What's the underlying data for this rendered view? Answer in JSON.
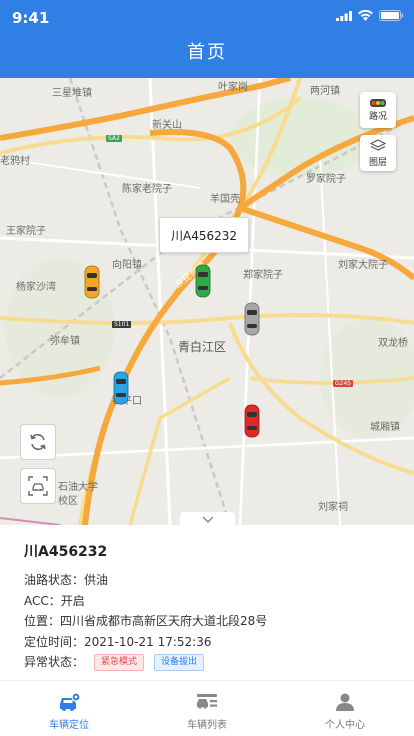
{
  "status_bar": {
    "time": "9:41"
  },
  "header": {
    "title": "首页"
  },
  "map": {
    "layer_buttons": [
      {
        "label": "路况",
        "icon": "traffic-light-icon"
      },
      {
        "label": "图层",
        "icon": "layers-icon"
      }
    ],
    "place_labels": [
      "三星堆镇",
      "叶家岗",
      "新关山",
      "老鸦村",
      "陈家老院子",
      "羊国壳",
      "罗家院子",
      "王家院子",
      "向阳镇",
      "郑家院子",
      "刘家大院子",
      "杨家沙湾",
      "弥牟镇",
      "青白江区",
      "双龙桥",
      "石平口",
      "城厢镇",
      "石油大学",
      "校区",
      "刘家祠",
      "两河镇"
    ],
    "road_badges": [
      "SA2",
      "S101",
      "G245"
    ],
    "expressway_label": "京昆高速",
    "popup_plate": "川A456232",
    "vehicles": [
      {
        "color": "#f5a623",
        "icon": "car-orange-icon"
      },
      {
        "color": "#2eaa4a",
        "icon": "car-green-icon"
      },
      {
        "color": "#9a9a9a",
        "icon": "car-gray-icon"
      },
      {
        "color": "#2ba3e6",
        "icon": "car-blue-icon"
      },
      {
        "color": "#e02a2a",
        "icon": "car-red-icon"
      }
    ]
  },
  "info": {
    "plate": "川A456232",
    "oil_label": "油路状态：",
    "oil_value": "供油",
    "acc_label": "ACC：",
    "acc_value": "开启",
    "location_label": "位置：",
    "location_value": "四川省成都市高新区天府大道北段28号",
    "time_label": "定位时间：",
    "time_value": "2021-10-21 17:52:36",
    "abnormal_label": "异常状态：",
    "tags": [
      "紧急模式",
      "设备拔出"
    ]
  },
  "tabbar": {
    "items": [
      {
        "label": "车辆定位",
        "icon": "car-location-icon",
        "active": true
      },
      {
        "label": "车辆列表",
        "icon": "vehicle-list-icon",
        "active": false
      },
      {
        "label": "个人中心",
        "icon": "person-icon",
        "active": false
      }
    ]
  },
  "colors": {
    "primary": "#2f7fe4",
    "expressway": "#f6a83c",
    "emergency": "#e04b4b"
  }
}
